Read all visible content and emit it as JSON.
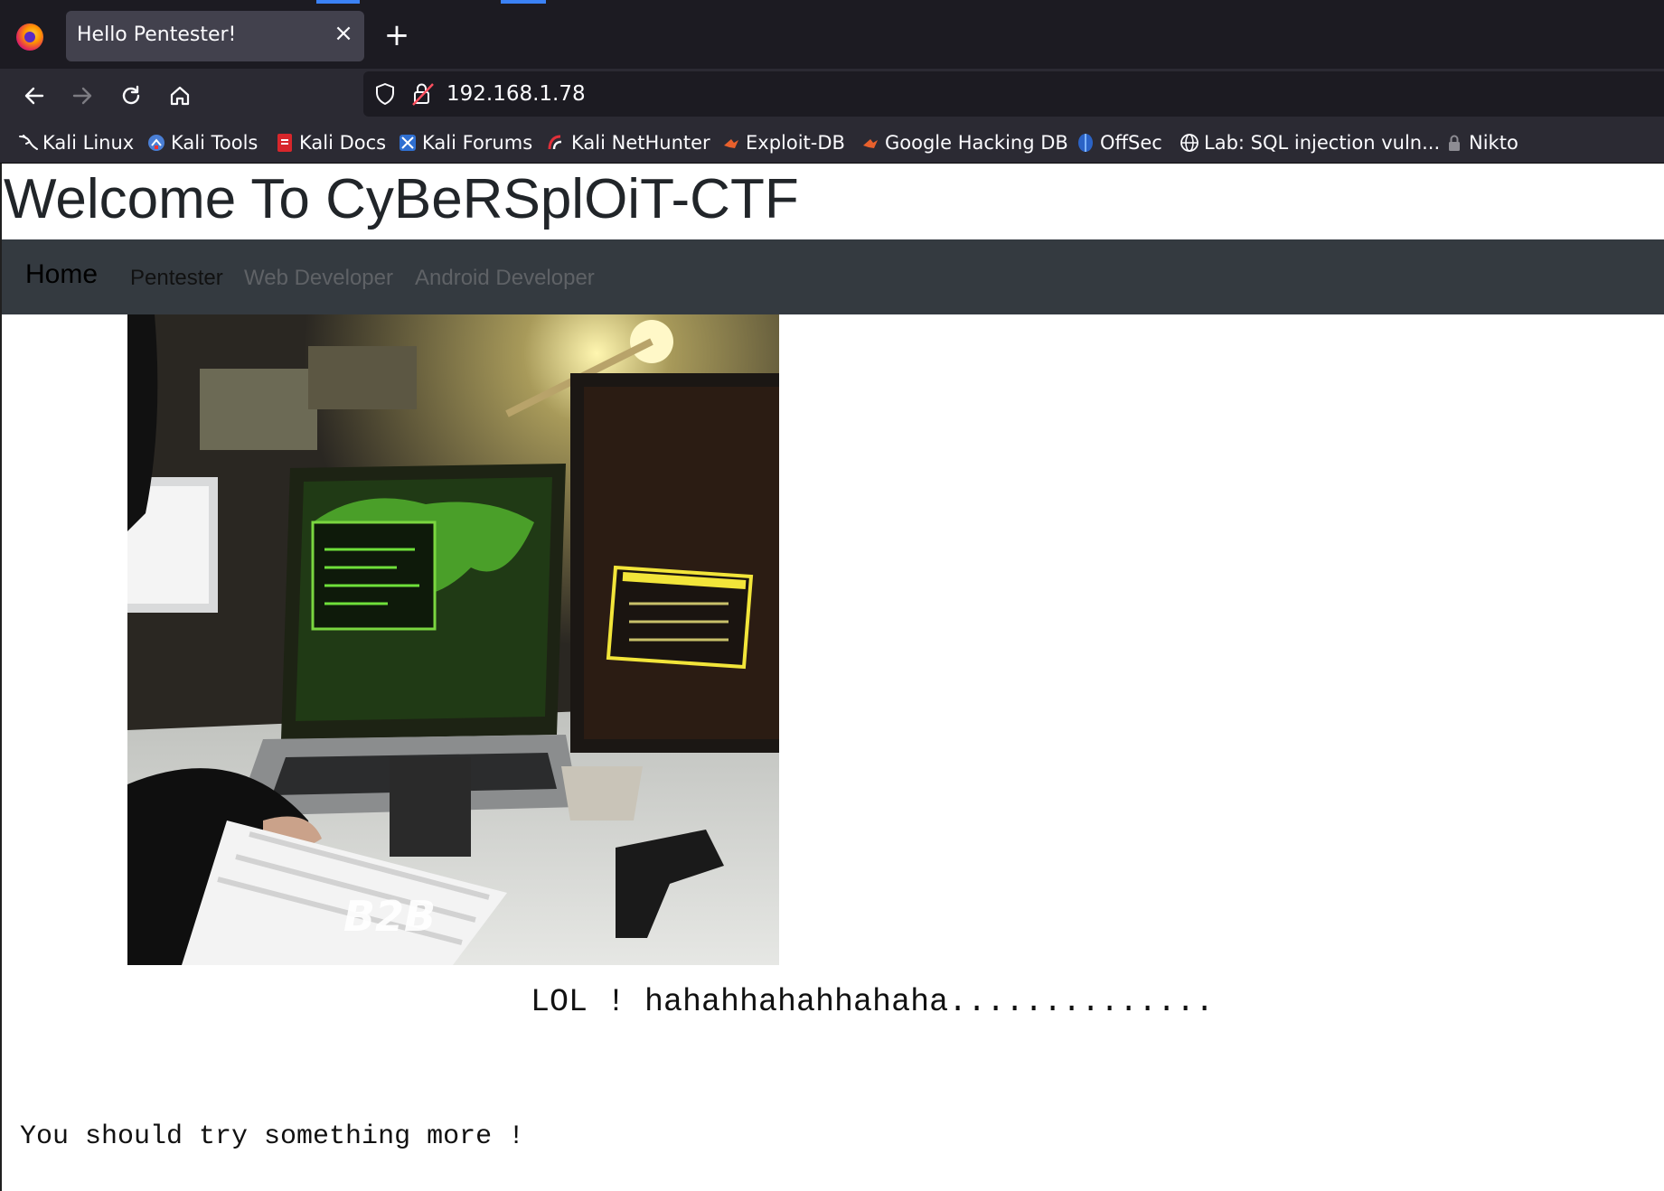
{
  "browser": {
    "tab_title": "Hello Pentester!",
    "url": "192.168.1.78",
    "bookmarks": [
      {
        "label": "Kali Linux",
        "icon": "kali-dragon-icon"
      },
      {
        "label": "Kali Tools",
        "icon": "kali-tools-icon"
      },
      {
        "label": "Kali Docs",
        "icon": "kali-docs-icon"
      },
      {
        "label": "Kali Forums",
        "icon": "kali-forums-icon"
      },
      {
        "label": "Kali NetHunter",
        "icon": "nethunter-icon"
      },
      {
        "label": "Exploit-DB",
        "icon": "exploit-db-icon"
      },
      {
        "label": "Google Hacking DB",
        "icon": "ghdb-icon"
      },
      {
        "label": "OffSec",
        "icon": "offsec-icon"
      },
      {
        "label": "Lab: SQL injection vuln...",
        "icon": "globe-icon"
      },
      {
        "label": "Nikto",
        "icon": "lock-icon"
      }
    ]
  },
  "site": {
    "title": "Welcome To CyBeRSplOiT-CTF",
    "nav": {
      "brand": "Home",
      "links": [
        {
          "label": "Pentester",
          "active": true
        },
        {
          "label": "Web Developer",
          "active": false
        },
        {
          "label": "Android Developer",
          "active": false
        }
      ]
    },
    "hero_watermark": "B2B",
    "message": "LOL ! hahahhahahhahaha..............",
    "footer_message": "You should try something more !"
  },
  "colors": {
    "chrome_dark": "#1c1b22",
    "chrome_mid": "#2b2a33",
    "site_nav": "#343a40",
    "link_active": "#111111",
    "link_muted": "#5f6266"
  }
}
